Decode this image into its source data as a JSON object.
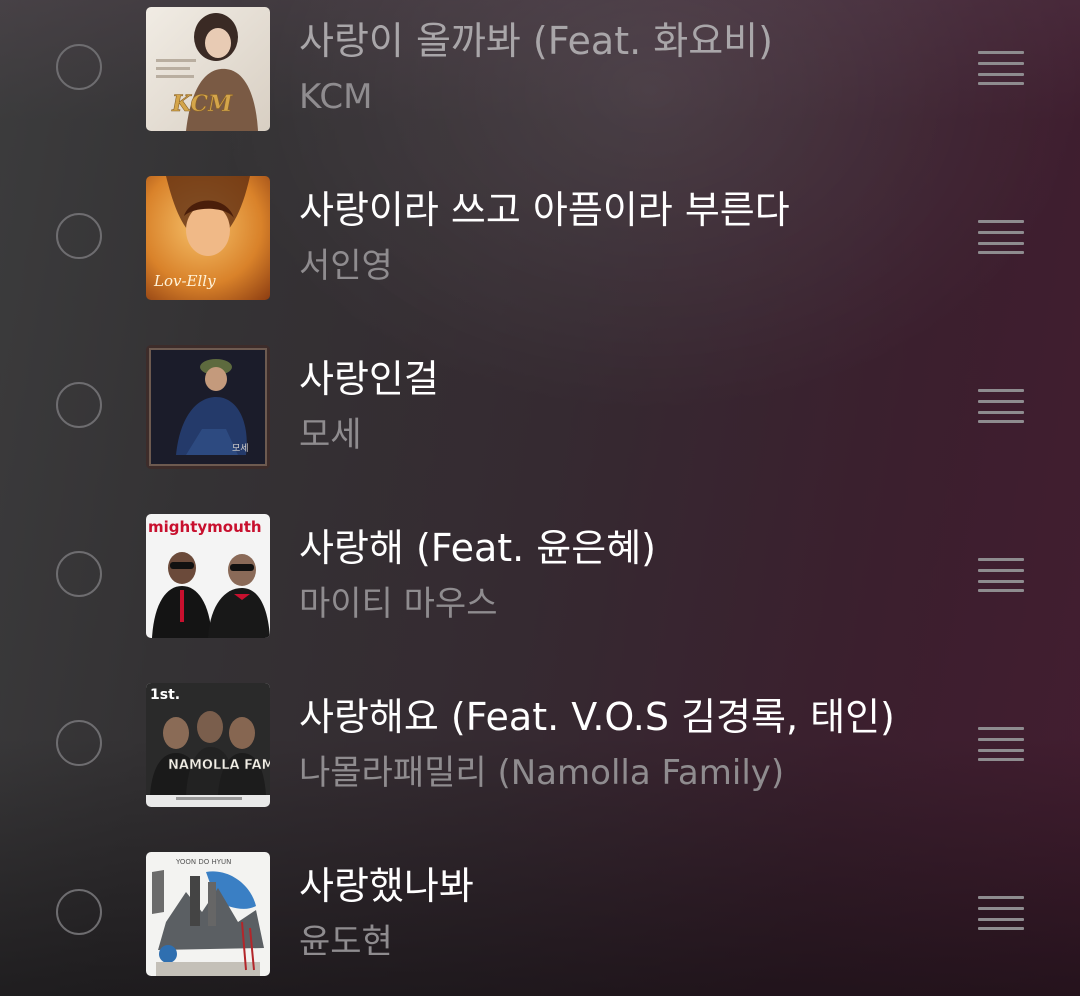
{
  "songs": [
    {
      "title": "사랑이 올까봐 (Feat. 화요비)",
      "artist": "KCM",
      "art_text": "KCM"
    },
    {
      "title": "사랑이라 쓰고 아픔이라 부른다",
      "artist": "서인영",
      "art_text": "Lov-Elly"
    },
    {
      "title": "사랑인걸",
      "artist": "모세",
      "art_text": "모세"
    },
    {
      "title": "사랑해 (Feat. 윤은혜)",
      "artist": "마이티 마우스",
      "art_text": "mightymouth"
    },
    {
      "title": "사랑해요 (Feat. V.O.S 김경록, 태인)",
      "artist": "나몰라패밀리 (Namolla Family)",
      "art_text": "NAMOLLA FAMILY"
    },
    {
      "title": "사랑했나봐",
      "artist": "윤도현",
      "art_text": "YOON DO HYUN"
    }
  ],
  "icons": {
    "select": "radio-unchecked-icon",
    "reorder": "drag-handle-icon"
  }
}
